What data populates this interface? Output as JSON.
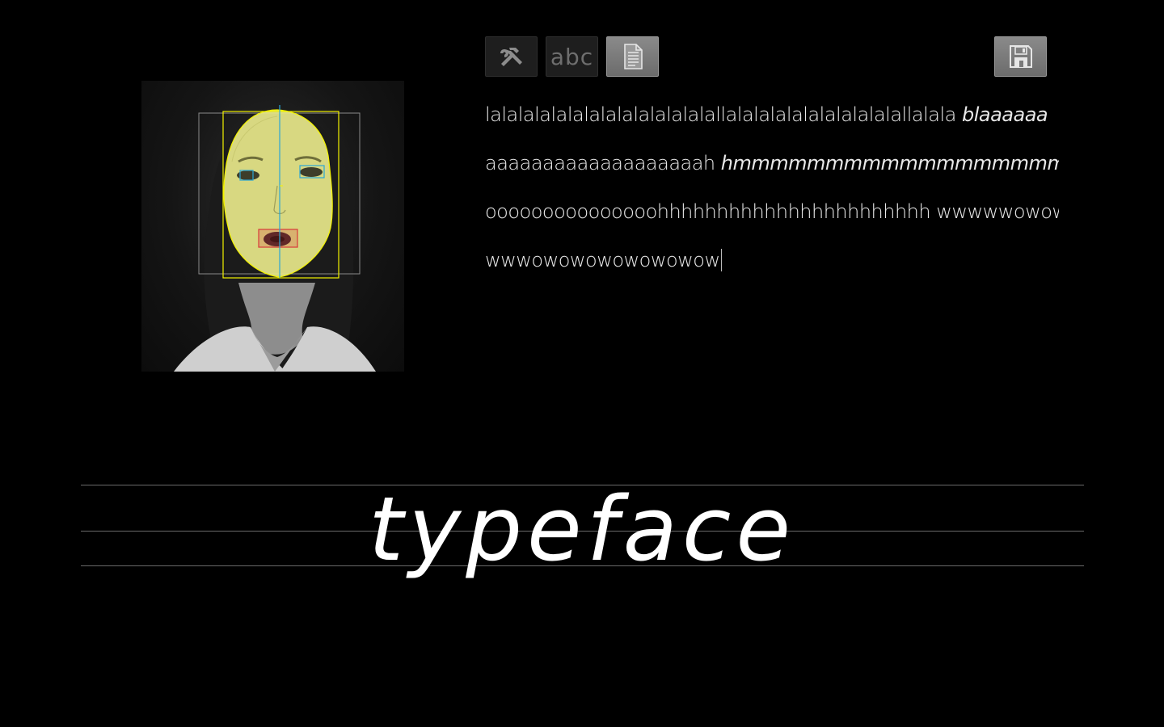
{
  "preview": {
    "label": "face-tracking-preview",
    "overlay_colors": {
      "face_fill": "#e8e88a",
      "face_outline": "#f2f200",
      "eye_box": "#2aa7d6",
      "mouth_box": "#d83a3a",
      "outer_box": "#8a8a8a",
      "midline": "#2aa7d6"
    }
  },
  "toolbar": {
    "tools_icon": "hammer-wrench-icon",
    "abc_label": "abc",
    "doc_icon": "document-icon",
    "save_icon": "floppy-disk-icon",
    "active_color": "#7a7a7a"
  },
  "written": {
    "line1a": "lalalalalalalalalalalalalalallalalalalalalalalalalallalala ",
    "line1b": "blaaaaaa",
    "line2a": "aaaaaaaaaaaaaaaaaaah ",
    "line2b": "hmmmmmmmmmmmmmmmmmmmmmmm",
    "line3": "ooooooooooooooohhhhhhhhhhhhhhhhhhhhhhh  wwwwwowowo",
    "line4": "wwwowowowowowowow"
  },
  "big_word": "typeface"
}
